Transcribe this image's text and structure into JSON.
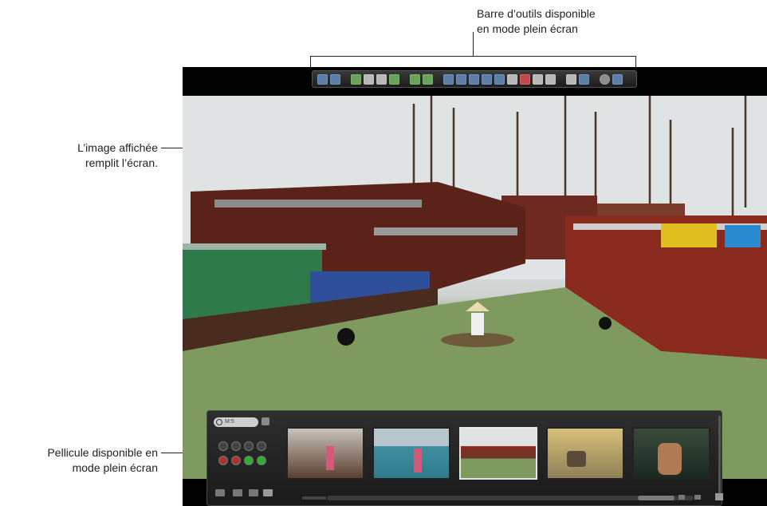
{
  "callouts": {
    "toolbar_line1": "Barre d’outils disponible",
    "toolbar_line2": "en mode plein écran",
    "image_line1": "L’image affichée",
    "image_line2": "remplit l’écran.",
    "filmstrip_line1": "Pellicule disponible en",
    "filmstrip_line2": "mode plein écran"
  },
  "filmstrip": {
    "search_value": "M:5",
    "thumbnail_count": 5,
    "selected_index": 2
  },
  "colors": {
    "screen_bg": "#000000",
    "toolbar_bg": "#2a2a2a",
    "water": "#7f9a5e",
    "boat_red": "#8a2a1e",
    "boat_green": "#2f7a4a"
  }
}
